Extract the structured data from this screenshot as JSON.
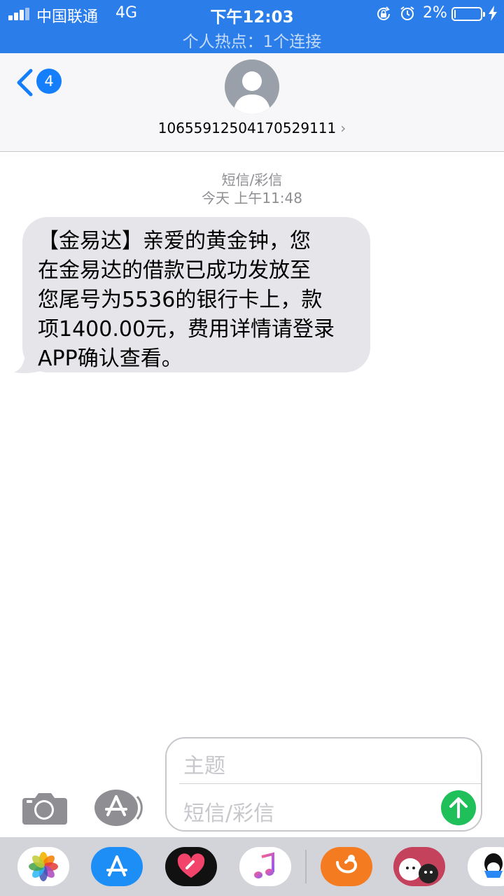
{
  "status_bar": {
    "carrier": "中国联通",
    "network": "4G",
    "time": "下午12:03",
    "battery_percent": "2%",
    "hotspot": "个人热点：1个连接",
    "icons": [
      "signal-icon",
      "rotation-lock-icon",
      "alarm-icon",
      "battery-icon",
      "charging-icon"
    ]
  },
  "header": {
    "back_badge": "4",
    "contact": "10655912504170529111"
  },
  "conversation": {
    "message_type": "短信/彩信",
    "timestamp": "今天 上午11:48",
    "messages": [
      {
        "direction": "incoming",
        "lines": [
          "【金易达】亲爱的黄金钟，您",
          "在金易达的借款已成功发放至",
          "您尾号为5536的银行卡上，款",
          "项1400.00元，费用详情请登录",
          "APP确认查看。"
        ]
      }
    ]
  },
  "composer": {
    "subject_placeholder": "主题",
    "message_placeholder": "短信/彩信"
  },
  "app_drawer": {
    "apps": [
      "photos-icon",
      "app-store-icon",
      "digital-touch-icon",
      "music-icon",
      "uc-browser-icon",
      "sticker-icon",
      "qq-icon"
    ]
  },
  "colors": {
    "status_bar_bg": "#2b7de9",
    "accent_blue": "#157efb",
    "incoming_bubble": "#e5e5ea",
    "send_green": "#1fc05a"
  }
}
